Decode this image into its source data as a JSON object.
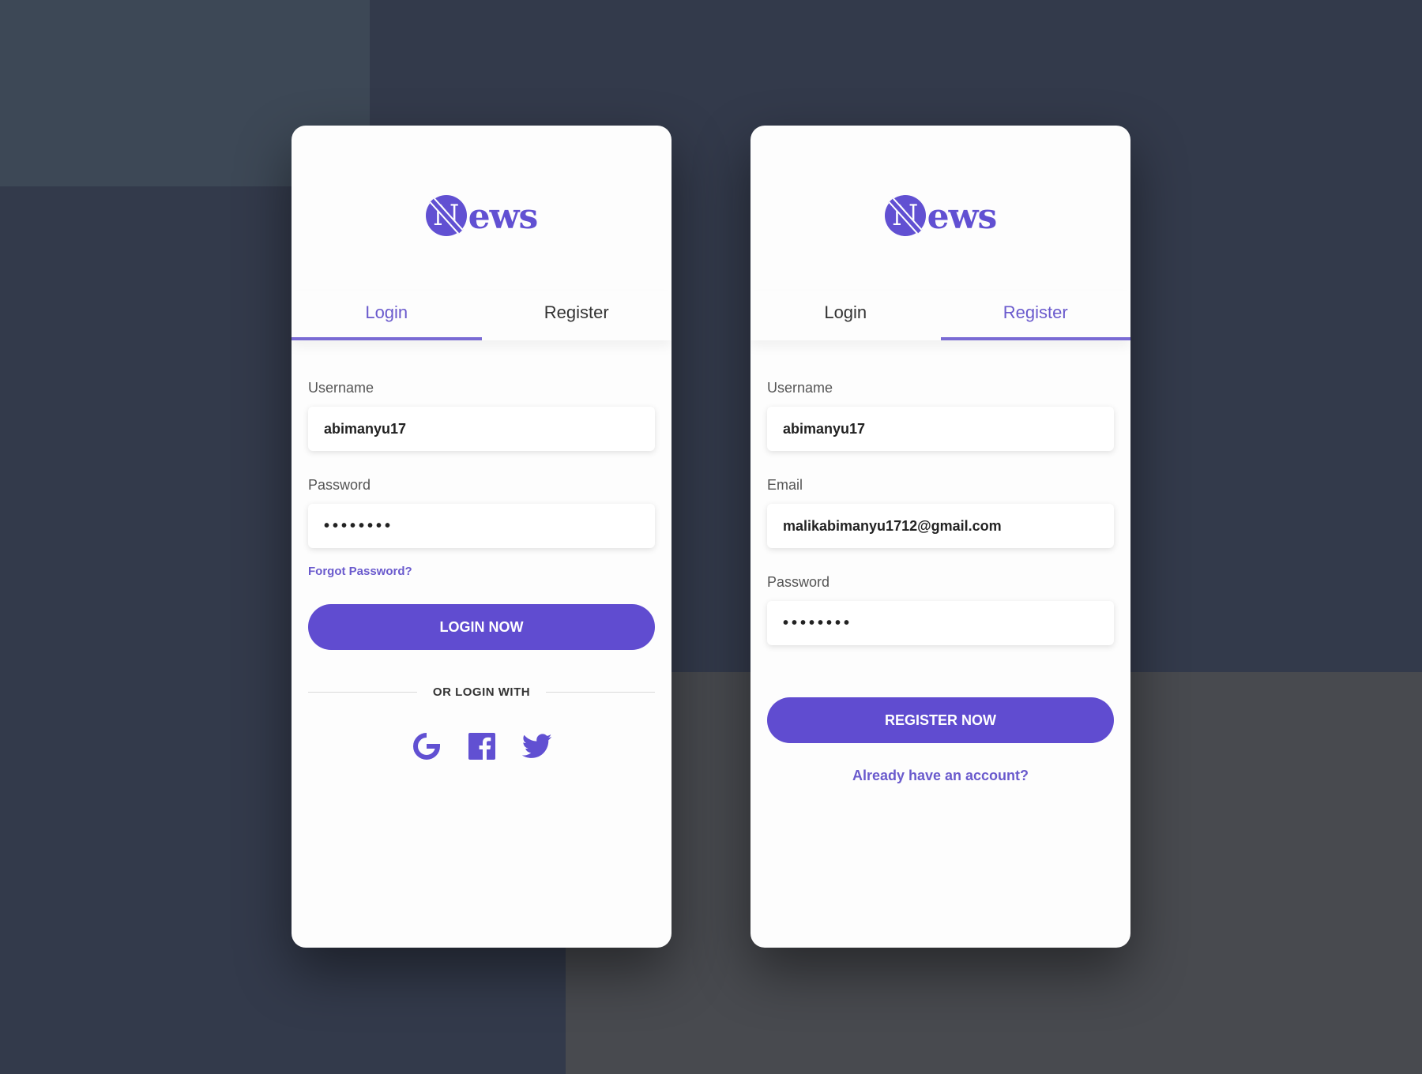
{
  "brand": {
    "logo_text": "ews",
    "logo_letter": "N",
    "accent_color": "#6150d2"
  },
  "login_card": {
    "tabs": [
      {
        "label": "Login",
        "active": true
      },
      {
        "label": "Register",
        "active": false
      }
    ],
    "username": {
      "label": "Username",
      "value": "abimanyu17"
    },
    "password": {
      "label": "Password",
      "value": "••••••••"
    },
    "forgot_password": "Forgot Password?",
    "submit_label": "LOGIN NOW",
    "divider_text": "OR LOGIN WITH",
    "social_icons": [
      "google-icon",
      "facebook-icon",
      "twitter-icon"
    ]
  },
  "register_card": {
    "tabs": [
      {
        "label": "Login",
        "active": false
      },
      {
        "label": "Register",
        "active": true
      }
    ],
    "username": {
      "label": "Username",
      "value": "abimanyu17"
    },
    "email": {
      "label": "Email",
      "value": "malikabimanyu1712@gmail.com"
    },
    "password": {
      "label": "Password",
      "value": "••••••••"
    },
    "submit_label": "REGISTER NOW",
    "already_account": "Already have an account?"
  }
}
